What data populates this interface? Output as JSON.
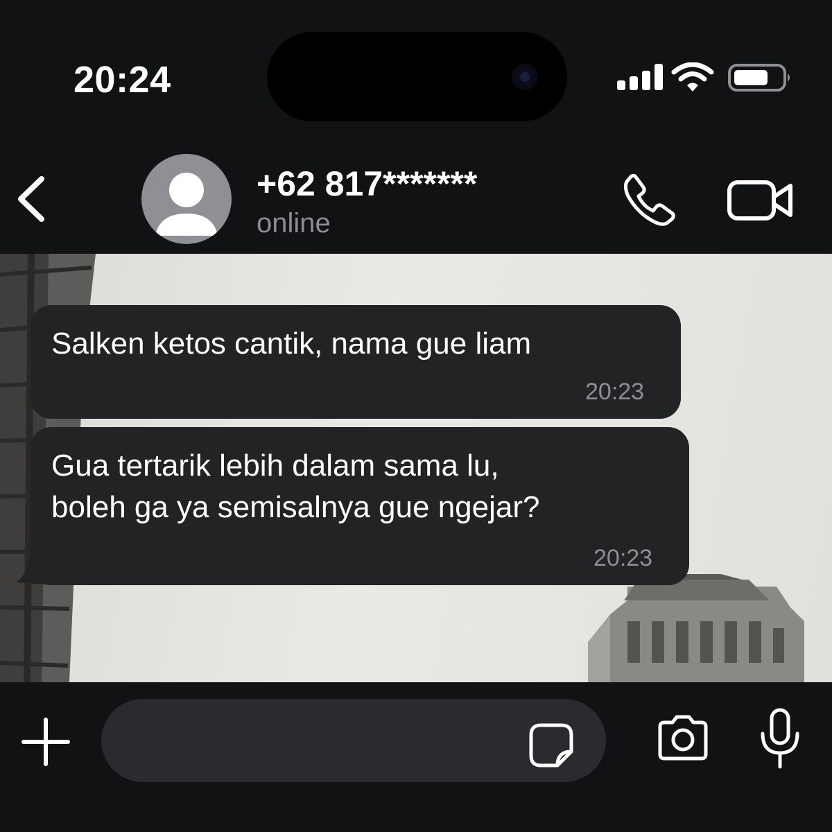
{
  "status_bar": {
    "time": "20:24",
    "icons": [
      "cellular-signal-icon",
      "wifi-icon",
      "battery-icon"
    ]
  },
  "header": {
    "contact_name": "+62 817*******",
    "contact_status": "online",
    "icons": [
      "back-chevron-icon",
      "default-avatar-icon",
      "phone-icon",
      "video-camera-icon"
    ]
  },
  "messages": [
    {
      "direction": "incoming",
      "text": "Salken ketos cantik, nama gue liam",
      "time": "20:23"
    },
    {
      "direction": "incoming",
      "lines": [
        "Gua tertarik lebih dalam sama lu,",
        "boleh ga ya semisalnya gue ngejar?"
      ],
      "time": "20:23"
    }
  ],
  "composer": {
    "input_value": "",
    "icons": [
      "plus-icon",
      "sticker-icon",
      "camera-icon",
      "microphone-icon"
    ]
  },
  "colors": {
    "background": "#111213",
    "bubble": "#212325",
    "secondary_text": "#8c8c92",
    "input_background": "#2a2b2e"
  }
}
